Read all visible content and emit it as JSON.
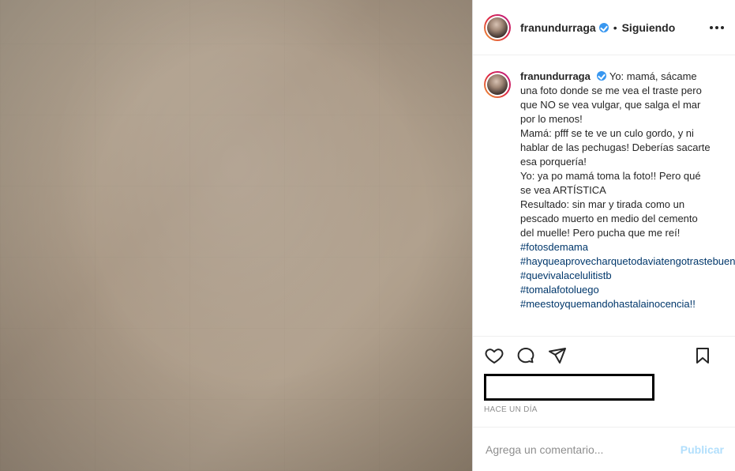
{
  "header": {
    "username": "franundurraga",
    "dot": "•",
    "following_label": "Siguiendo"
  },
  "caption": {
    "username": "franundurraga",
    "lines": [
      "Yo: mamá, sácame una foto donde se me vea el traste pero que NO se vea vulgar, que salga el mar por lo menos!",
      "Mamá: pfff se te ve un culo gordo, y ni hablar de las pechugas! Deberías sacarte esa porquería!",
      "Yo: ya po mamá toma la foto!! Pero qué se vea ARTÍSTICA",
      "Resultado: sin mar y tirada como un pescado muerto en medio del cemento del muelle! Pero pucha que me reí!"
    ],
    "hashtags": [
      "#fotosdemama",
      "#hayqueaprovecharquetodaviatengotrastebueno",
      "#quevivalacelulitistb",
      "#tomalafotoluego",
      "#meestoyquemandohastalainocencia!!"
    ]
  },
  "post": {
    "time_ago": "HACE UN DÍA"
  },
  "comment": {
    "placeholder": "Agrega un comentario...",
    "publish_label": "Publicar"
  },
  "icons": {
    "heart": "heart-icon",
    "comment": "comment-icon",
    "share": "share-icon",
    "bookmark": "bookmark-icon",
    "more": "more-options-icon",
    "verified": "verified-badge-icon"
  }
}
